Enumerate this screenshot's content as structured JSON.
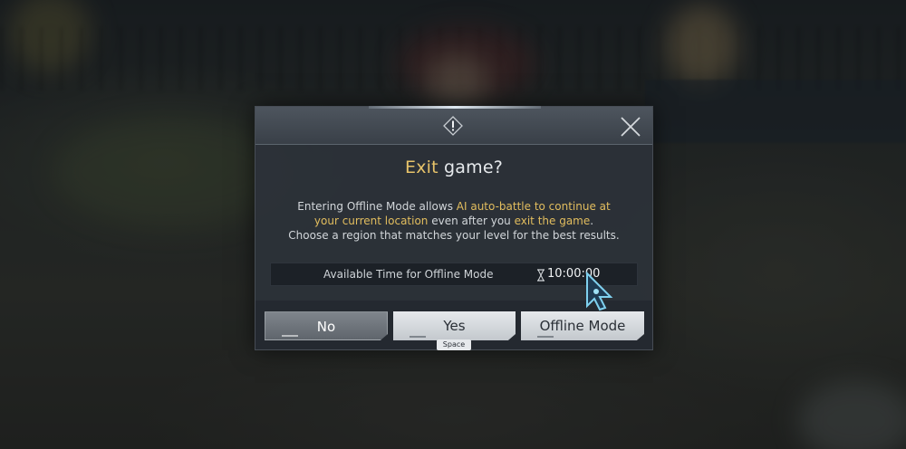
{
  "dialog": {
    "title_highlight": "Exit",
    "title_rest": " game?",
    "description": {
      "part1": "Entering Offline Mode allows ",
      "highlight1": "AI auto-battle to continue at",
      "highlight2": "your current location",
      "part2": " even after you ",
      "highlight3": "exit the game",
      "part3": ".",
      "line3": "Choose a region that matches your level for the best results."
    },
    "offline_time": {
      "label": "Available Time for Offline Mode",
      "value": "10:00:00"
    },
    "buttons": {
      "no": "No",
      "yes": "Yes",
      "offline": "Offline Mode"
    },
    "yes_key_hint": "Space"
  },
  "icons": {
    "alert": "exclamation-diamond-icon",
    "close": "close-x-icon",
    "hourglass": "hourglass-icon",
    "cursor": "arrow-cursor-icon"
  },
  "colors": {
    "highlight": "#e2bd5e",
    "panel": "#2c323a",
    "button_light": "#e6e9ec",
    "button_dark": "#6f757c"
  }
}
